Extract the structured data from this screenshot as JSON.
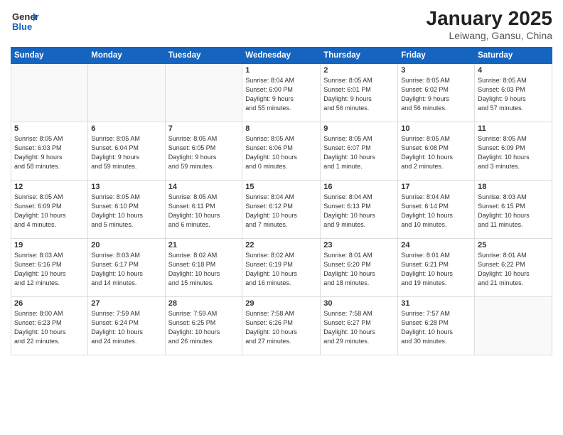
{
  "logo": {
    "line1": "General",
    "line2": "Blue"
  },
  "title": "January 2025",
  "location": "Leiwang, Gansu, China",
  "days_of_week": [
    "Sunday",
    "Monday",
    "Tuesday",
    "Wednesday",
    "Thursday",
    "Friday",
    "Saturday"
  ],
  "weeks": [
    [
      {
        "day": "",
        "info": ""
      },
      {
        "day": "",
        "info": ""
      },
      {
        "day": "",
        "info": ""
      },
      {
        "day": "1",
        "info": "Sunrise: 8:04 AM\nSunset: 6:00 PM\nDaylight: 9 hours\nand 55 minutes."
      },
      {
        "day": "2",
        "info": "Sunrise: 8:05 AM\nSunset: 6:01 PM\nDaylight: 9 hours\nand 56 minutes."
      },
      {
        "day": "3",
        "info": "Sunrise: 8:05 AM\nSunset: 6:02 PM\nDaylight: 9 hours\nand 56 minutes."
      },
      {
        "day": "4",
        "info": "Sunrise: 8:05 AM\nSunset: 6:03 PM\nDaylight: 9 hours\nand 57 minutes."
      }
    ],
    [
      {
        "day": "5",
        "info": "Sunrise: 8:05 AM\nSunset: 6:03 PM\nDaylight: 9 hours\nand 58 minutes."
      },
      {
        "day": "6",
        "info": "Sunrise: 8:05 AM\nSunset: 6:04 PM\nDaylight: 9 hours\nand 59 minutes."
      },
      {
        "day": "7",
        "info": "Sunrise: 8:05 AM\nSunset: 6:05 PM\nDaylight: 9 hours\nand 59 minutes."
      },
      {
        "day": "8",
        "info": "Sunrise: 8:05 AM\nSunset: 6:06 PM\nDaylight: 10 hours\nand 0 minutes."
      },
      {
        "day": "9",
        "info": "Sunrise: 8:05 AM\nSunset: 6:07 PM\nDaylight: 10 hours\nand 1 minute."
      },
      {
        "day": "10",
        "info": "Sunrise: 8:05 AM\nSunset: 6:08 PM\nDaylight: 10 hours\nand 2 minutes."
      },
      {
        "day": "11",
        "info": "Sunrise: 8:05 AM\nSunset: 6:09 PM\nDaylight: 10 hours\nand 3 minutes."
      }
    ],
    [
      {
        "day": "12",
        "info": "Sunrise: 8:05 AM\nSunset: 6:09 PM\nDaylight: 10 hours\nand 4 minutes."
      },
      {
        "day": "13",
        "info": "Sunrise: 8:05 AM\nSunset: 6:10 PM\nDaylight: 10 hours\nand 5 minutes."
      },
      {
        "day": "14",
        "info": "Sunrise: 8:05 AM\nSunset: 6:11 PM\nDaylight: 10 hours\nand 6 minutes."
      },
      {
        "day": "15",
        "info": "Sunrise: 8:04 AM\nSunset: 6:12 PM\nDaylight: 10 hours\nand 7 minutes."
      },
      {
        "day": "16",
        "info": "Sunrise: 8:04 AM\nSunset: 6:13 PM\nDaylight: 10 hours\nand 9 minutes."
      },
      {
        "day": "17",
        "info": "Sunrise: 8:04 AM\nSunset: 6:14 PM\nDaylight: 10 hours\nand 10 minutes."
      },
      {
        "day": "18",
        "info": "Sunrise: 8:03 AM\nSunset: 6:15 PM\nDaylight: 10 hours\nand 11 minutes."
      }
    ],
    [
      {
        "day": "19",
        "info": "Sunrise: 8:03 AM\nSunset: 6:16 PM\nDaylight: 10 hours\nand 12 minutes."
      },
      {
        "day": "20",
        "info": "Sunrise: 8:03 AM\nSunset: 6:17 PM\nDaylight: 10 hours\nand 14 minutes."
      },
      {
        "day": "21",
        "info": "Sunrise: 8:02 AM\nSunset: 6:18 PM\nDaylight: 10 hours\nand 15 minutes."
      },
      {
        "day": "22",
        "info": "Sunrise: 8:02 AM\nSunset: 6:19 PM\nDaylight: 10 hours\nand 16 minutes."
      },
      {
        "day": "23",
        "info": "Sunrise: 8:01 AM\nSunset: 6:20 PM\nDaylight: 10 hours\nand 18 minutes."
      },
      {
        "day": "24",
        "info": "Sunrise: 8:01 AM\nSunset: 6:21 PM\nDaylight: 10 hours\nand 19 minutes."
      },
      {
        "day": "25",
        "info": "Sunrise: 8:01 AM\nSunset: 6:22 PM\nDaylight: 10 hours\nand 21 minutes."
      }
    ],
    [
      {
        "day": "26",
        "info": "Sunrise: 8:00 AM\nSunset: 6:23 PM\nDaylight: 10 hours\nand 22 minutes."
      },
      {
        "day": "27",
        "info": "Sunrise: 7:59 AM\nSunset: 6:24 PM\nDaylight: 10 hours\nand 24 minutes."
      },
      {
        "day": "28",
        "info": "Sunrise: 7:59 AM\nSunset: 6:25 PM\nDaylight: 10 hours\nand 26 minutes."
      },
      {
        "day": "29",
        "info": "Sunrise: 7:58 AM\nSunset: 6:26 PM\nDaylight: 10 hours\nand 27 minutes."
      },
      {
        "day": "30",
        "info": "Sunrise: 7:58 AM\nSunset: 6:27 PM\nDaylight: 10 hours\nand 29 minutes."
      },
      {
        "day": "31",
        "info": "Sunrise: 7:57 AM\nSunset: 6:28 PM\nDaylight: 10 hours\nand 30 minutes."
      },
      {
        "day": "",
        "info": ""
      }
    ]
  ]
}
